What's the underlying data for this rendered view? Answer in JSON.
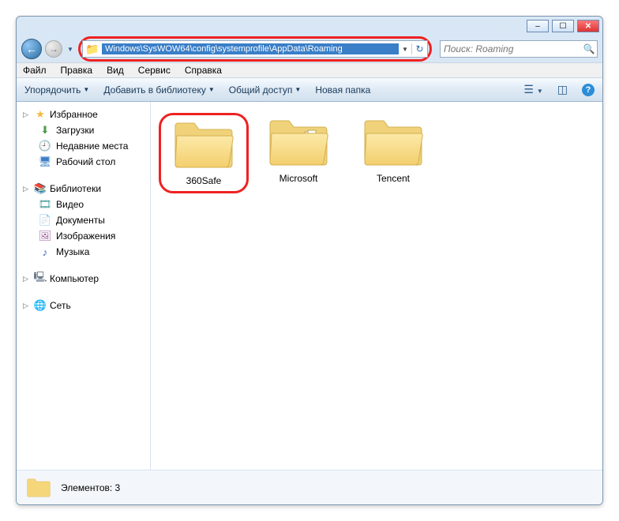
{
  "titlebar": {
    "min": "–",
    "max": "☐",
    "close": "✕"
  },
  "nav": {
    "back": "←",
    "fwd": "→",
    "drop": "▼",
    "refresh": "↻"
  },
  "addressbar": {
    "path": "Windows\\SysWOW64\\config\\systemprofile\\AppData\\Roaming"
  },
  "search": {
    "placeholder": "Поиск: Roaming"
  },
  "menubar": [
    "Файл",
    "Правка",
    "Вид",
    "Сервис",
    "Справка"
  ],
  "toolbar": {
    "organize": "Упорядочить",
    "addlib": "Добавить в библиотеку",
    "share": "Общий доступ",
    "newfolder": "Новая папка"
  },
  "sidebar": {
    "favorites": {
      "label": "Избранное",
      "items": [
        {
          "label": "Загрузки"
        },
        {
          "label": "Недавние места"
        },
        {
          "label": "Рабочий стол"
        }
      ]
    },
    "libraries": {
      "label": "Библиотеки",
      "items": [
        {
          "label": "Видео"
        },
        {
          "label": "Документы"
        },
        {
          "label": "Изображения"
        },
        {
          "label": "Музыка"
        }
      ]
    },
    "computer": {
      "label": "Компьютер"
    },
    "network": {
      "label": "Сеть"
    }
  },
  "folders": [
    {
      "name": "360Safe",
      "highlighted": true
    },
    {
      "name": "Microsoft",
      "highlighted": false
    },
    {
      "name": "Tencent",
      "highlighted": false
    }
  ],
  "statusbar": {
    "count": "Элементов: 3"
  }
}
